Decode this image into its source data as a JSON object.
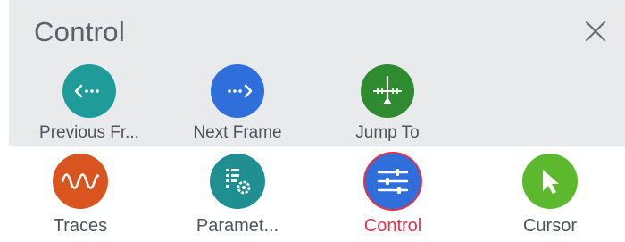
{
  "panel": {
    "title": "Control",
    "close_icon": "close-icon"
  },
  "actions": [
    {
      "label": "Previous Fr...",
      "icon": "previous-frame-icon",
      "color": "#1f9c9a"
    },
    {
      "label": "Next Frame",
      "icon": "next-frame-icon",
      "color": "#2e6fdc"
    },
    {
      "label": "Jump To",
      "icon": "jump-to-icon",
      "color": "#2e8b2f"
    }
  ],
  "tabs": [
    {
      "label": "Traces",
      "icon": "waveform-icon",
      "color": "#d9541e",
      "active": false
    },
    {
      "label": "Paramet...",
      "icon": "parameters-icon",
      "color": "#1f8f91",
      "active": false
    },
    {
      "label": "Control",
      "icon": "sliders-icon",
      "color": "#2e6fdc",
      "active": true
    },
    {
      "label": "Cursor",
      "icon": "cursor-icon",
      "color": "#5cb82c",
      "active": false
    }
  ],
  "colors": {
    "active_tab": "#e5304c",
    "panel_background": "#e8eaec"
  }
}
